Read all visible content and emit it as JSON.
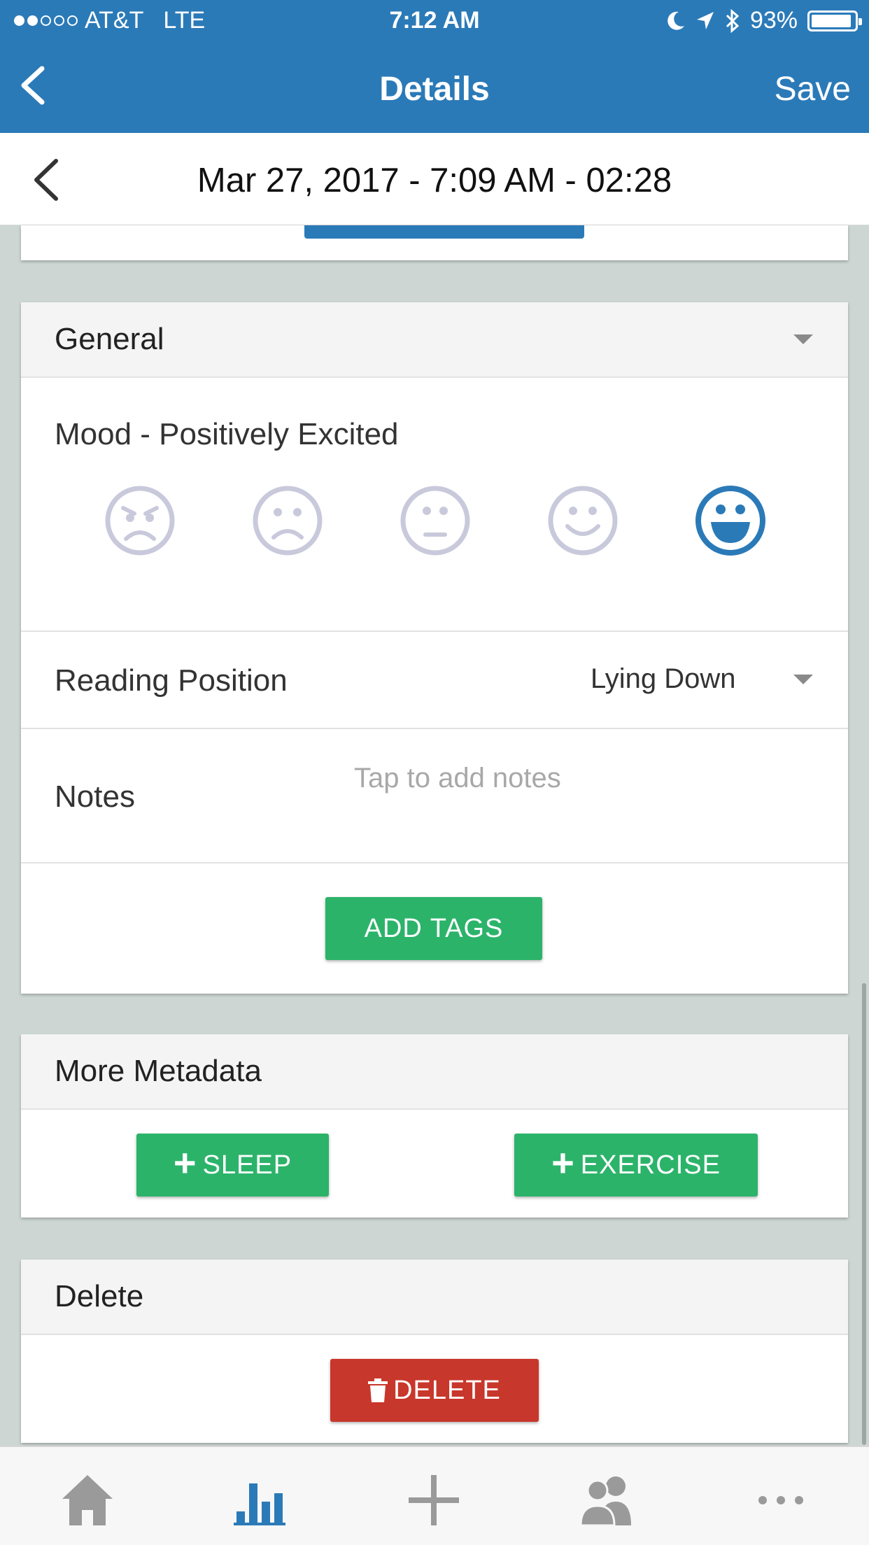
{
  "status_bar": {
    "carrier": "AT&T",
    "network": "LTE",
    "time": "7:12 AM",
    "battery": "93%",
    "signal_bars": 2,
    "signal_total": 5
  },
  "nav": {
    "title": "Details",
    "save_label": "Save",
    "back_icon": "chevron-left-icon"
  },
  "date_bar": {
    "text": "Mar 27, 2017 - 7:09 AM - 02:28"
  },
  "general": {
    "header": "General",
    "mood_label": "Mood - Positively Excited",
    "moods": [
      {
        "name": "angry-face-icon",
        "selected": false
      },
      {
        "name": "sad-face-icon",
        "selected": false
      },
      {
        "name": "neutral-face-icon",
        "selected": false
      },
      {
        "name": "smile-face-icon",
        "selected": false
      },
      {
        "name": "excited-face-icon",
        "selected": true
      }
    ],
    "reading_position_label": "Reading Position",
    "reading_position_value": "Lying Down",
    "notes_label": "Notes",
    "notes_placeholder": "Tap to add notes",
    "add_tags_label": "ADD TAGS"
  },
  "metadata": {
    "header": "More Metadata",
    "sleep_label": "SLEEP",
    "exercise_label": "EXERCISE"
  },
  "delete": {
    "header": "Delete",
    "delete_label": "DELETE"
  },
  "tab_bar": {
    "items": [
      {
        "icon": "home-icon",
        "active": false
      },
      {
        "icon": "bar-chart-icon",
        "active": true
      },
      {
        "icon": "plus-icon",
        "active": false
      },
      {
        "icon": "friends-icon",
        "active": false
      },
      {
        "icon": "more-icon",
        "active": false
      }
    ]
  },
  "colors": {
    "primary": "#2b7ab8",
    "green": "#2cb36a",
    "red": "#c8372b",
    "face_inactive": "#c9c9dc",
    "tab_inactive": "#9a9a9a"
  }
}
